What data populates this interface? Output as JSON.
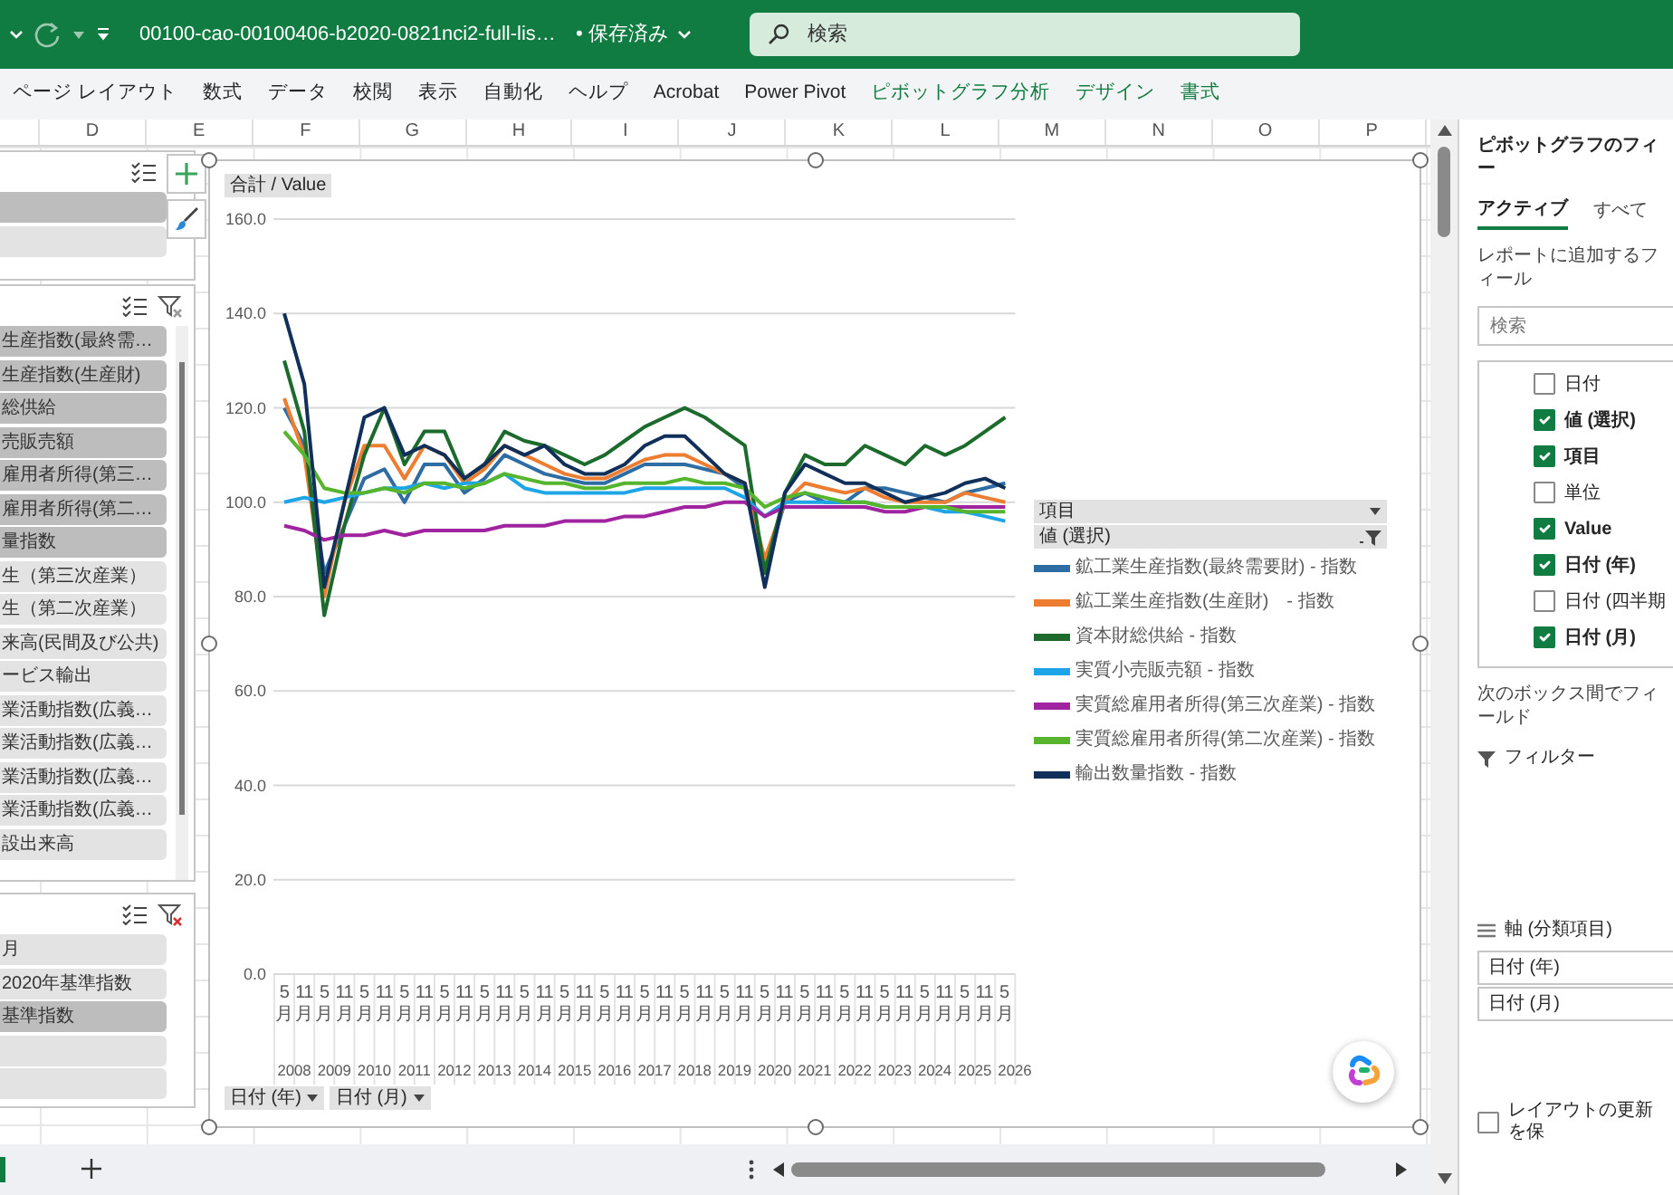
{
  "title_bar": {
    "file_name": "00100-cao-00100406-b2020-0821nci2-full-lis…",
    "save_status": "• 保存済み",
    "search_placeholder": "検索"
  },
  "ribbon_tabs": [
    {
      "label": "ページ レイアウト",
      "contextual": false
    },
    {
      "label": "数式",
      "contextual": false
    },
    {
      "label": "データ",
      "contextual": false
    },
    {
      "label": "校閲",
      "contextual": false
    },
    {
      "label": "表示",
      "contextual": false
    },
    {
      "label": "自動化",
      "contextual": false
    },
    {
      "label": "ヘルプ",
      "contextual": false
    },
    {
      "label": "Acrobat",
      "contextual": false
    },
    {
      "label": "Power Pivot",
      "contextual": false
    },
    {
      "label": "ピボットグラフ分析",
      "contextual": true
    },
    {
      "label": "デザイン",
      "contextual": true
    },
    {
      "label": "書式",
      "contextual": true
    }
  ],
  "column_headers": [
    "D",
    "E",
    "F",
    "G",
    "H",
    "I",
    "J",
    "K",
    "L",
    "M",
    "N",
    "O",
    "P"
  ],
  "slicers": [
    {
      "kind": "style_panel",
      "items": [
        {
          "selected": true
        },
        {
          "selected": false
        }
      ]
    },
    {
      "kind": "slicer",
      "filter_active": false,
      "items": [
        {
          "label": "生産指数(最終需…",
          "selected": true
        },
        {
          "label": "生産指数(生産財)",
          "selected": true
        },
        {
          "label": "総供給",
          "selected": true
        },
        {
          "label": "売販売額",
          "selected": true
        },
        {
          "label": "雇用者所得(第三…",
          "selected": true
        },
        {
          "label": "雇用者所得(第二…",
          "selected": true
        },
        {
          "label": "量指数",
          "selected": true
        },
        {
          "label": "生（第三次産業）",
          "selected": false
        },
        {
          "label": "生（第二次産業）",
          "selected": false
        },
        {
          "label": "来高(民間及び公共)",
          "selected": false
        },
        {
          "label": "ービス輸出",
          "selected": false
        },
        {
          "label": "業活動指数(広義…",
          "selected": false
        },
        {
          "label": "業活動指数(広義…",
          "selected": false
        },
        {
          "label": "業活動指数(広義…",
          "selected": false
        },
        {
          "label": "業活動指数(広義…",
          "selected": false
        },
        {
          "label": "設出来高",
          "selected": false
        }
      ]
    },
    {
      "kind": "slicer",
      "filter_active": true,
      "items": [
        {
          "label": "月",
          "selected": false
        },
        {
          "label": "2020年基準指数",
          "selected": false
        },
        {
          "label": "基準指数",
          "selected": true
        },
        {
          "selected": false
        },
        {
          "selected": false
        }
      ]
    }
  ],
  "chart": {
    "value_field_button": "合計 / Value",
    "legend": {
      "field_button": "項目",
      "filter_button": "値 (選択)"
    },
    "axis_field_buttons": [
      "日付 (年)",
      "日付 (月)"
    ],
    "year_labels": [
      "2008",
      "2009",
      "2010",
      "2011",
      "2012",
      "2013",
      "2014",
      "2015",
      "2016",
      "2017",
      "2018",
      "2019",
      "2020",
      "2021",
      "2022",
      "2023",
      "2024",
      "2025",
      "2026"
    ],
    "chart_data": {
      "type": "line",
      "grid": true,
      "legend": true,
      "categories": [
        "5月",
        "11月",
        "5月",
        "11月",
        "5月",
        "11月",
        "5月",
        "11月",
        "5月",
        "11月",
        "5月",
        "11月",
        "5月",
        "11月",
        "5月",
        "11月",
        "5月",
        "11月",
        "5月",
        "11月",
        "5月",
        "11月",
        "5月",
        "11月",
        "5月",
        "11月",
        "5月",
        "11月",
        "5月",
        "11月",
        "5月",
        "11月",
        "5月",
        "11月",
        "5月",
        "11月",
        "5月"
      ],
      "ylim": [
        0,
        160
      ],
      "yticks": [
        {
          "value": 0,
          "label": "0.0"
        },
        {
          "value": 20,
          "label": "20.0"
        },
        {
          "value": 40,
          "label": "40.0"
        },
        {
          "value": 60,
          "label": "60.0"
        },
        {
          "value": 80,
          "label": "80.0"
        },
        {
          "value": 100,
          "label": "100.0"
        },
        {
          "value": 120,
          "label": "120.0"
        },
        {
          "value": 140,
          "label": "140.0"
        },
        {
          "value": 160,
          "label": "160.0"
        }
      ],
      "series": [
        {
          "name": "鉱工業生産指数(最終需要財) - 指数",
          "color": "#2e6da4",
          "values": [
            120,
            112,
            85,
            95,
            105,
            107,
            100,
            108,
            108,
            102,
            105,
            110,
            108,
            106,
            105,
            104,
            104,
            106,
            108,
            108,
            108,
            107,
            106,
            103,
            86,
            100,
            102,
            100,
            100,
            103,
            103,
            102,
            101,
            100,
            102,
            103,
            104
          ]
        },
        {
          "name": "鉱工業生産指数(生産財)　- 指数",
          "color": "#ed7d31",
          "values": [
            122,
            110,
            80,
            100,
            112,
            112,
            105,
            112,
            110,
            104,
            107,
            112,
            110,
            108,
            106,
            105,
            105,
            107,
            109,
            110,
            110,
            108,
            106,
            104,
            88,
            100,
            104,
            103,
            102,
            103,
            101,
            100,
            100,
            100,
            102,
            101,
            100
          ]
        },
        {
          "name": "資本財総供給 - 指数",
          "color": "#1d6b2c",
          "values": [
            130,
            115,
            76,
            95,
            110,
            120,
            108,
            115,
            115,
            105,
            108,
            115,
            113,
            112,
            110,
            108,
            110,
            113,
            116,
            118,
            120,
            118,
            115,
            112,
            85,
            102,
            110,
            108,
            108,
            112,
            110,
            108,
            112,
            110,
            112,
            115,
            118
          ]
        },
        {
          "name": "実質小売販売額 - 指数",
          "color": "#1ea5e8",
          "values": [
            100,
            101,
            100,
            101,
            102,
            103,
            103,
            104,
            103,
            104,
            104,
            106,
            103,
            102,
            102,
            102,
            102,
            102,
            103,
            103,
            103,
            103,
            103,
            101,
            97,
            100,
            100,
            100,
            100,
            100,
            99,
            99,
            99,
            98,
            98,
            97,
            96
          ]
        },
        {
          "name": "実質総雇用者所得(第三次産業) - 指数",
          "color": "#a0239f",
          "values": [
            95,
            94,
            92,
            93,
            93,
            94,
            93,
            94,
            94,
            94,
            94,
            95,
            95,
            95,
            96,
            96,
            96,
            97,
            97,
            98,
            99,
            99,
            100,
            100,
            97,
            99,
            99,
            99,
            99,
            99,
            98,
            98,
            99,
            99,
            99,
            99,
            99
          ]
        },
        {
          "name": "実質総雇用者所得(第二次産業) - 指数",
          "color": "#57b52d",
          "values": [
            115,
            110,
            103,
            102,
            102,
            103,
            102,
            104,
            104,
            103,
            104,
            106,
            105,
            104,
            104,
            103,
            103,
            104,
            104,
            104,
            105,
            104,
            104,
            103,
            99,
            101,
            102,
            101,
            100,
            100,
            99,
            99,
            99,
            99,
            98,
            98,
            98
          ]
        },
        {
          "name": "輸出数量指数 - 指数",
          "color": "#10305a",
          "values": [
            140,
            125,
            82,
            100,
            118,
            120,
            110,
            112,
            110,
            105,
            108,
            112,
            110,
            112,
            108,
            106,
            106,
            108,
            112,
            114,
            114,
            110,
            106,
            104,
            82,
            102,
            108,
            106,
            104,
            104,
            102,
            100,
            101,
            102,
            104,
            105,
            103
          ]
        }
      ]
    }
  },
  "field_pane": {
    "title": "ピボットグラフのフィー",
    "tabs": [
      {
        "label": "アクティブ",
        "selected": true
      },
      {
        "label": "すべて",
        "selected": false
      }
    ],
    "instruction": "レポートに追加するフィール",
    "search_placeholder": "検索",
    "fields": [
      {
        "label": "日付",
        "checked": false
      },
      {
        "label": "値 (選択)",
        "checked": true
      },
      {
        "label": "項目",
        "checked": true
      },
      {
        "label": "単位",
        "checked": false
      },
      {
        "label": "Value",
        "checked": true
      },
      {
        "label": "日付 (年)",
        "checked": true
      },
      {
        "label": "日付 (四半期",
        "checked": false
      },
      {
        "label": "日付 (月)",
        "checked": true
      }
    ],
    "areas_hint": "次のボックス間でフィールド",
    "filters_label": "フィルター",
    "axis_label": "軸 (分類項目)",
    "axis_items": [
      "日付 (年)",
      "日付 (月)"
    ],
    "defer_update": {
      "label": "レイアウトの更新を保",
      "checked": false
    }
  }
}
